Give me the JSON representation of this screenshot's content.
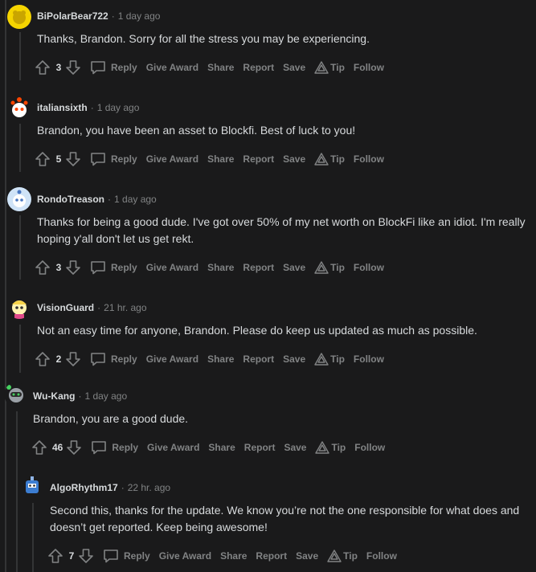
{
  "comments": [
    {
      "user": "BiPolarBear722",
      "time": "1 day ago",
      "body": "Thanks, Brandon. Sorry for all the stress you may be experiencing.",
      "score": "3"
    },
    {
      "user": "italiansixth",
      "time": "1 day ago",
      "body": "Brandon, you have been an asset to Blockfi. Best of luck to you!",
      "score": "5"
    },
    {
      "user": "RondoTreason",
      "time": "1 day ago",
      "body": "Thanks for being a good dude. I've got over 50% of my net worth on BlockFi like an idiot. I'm really hoping y'all don't let us get rekt.",
      "score": "3"
    },
    {
      "user": "VisionGuard",
      "time": "21 hr. ago",
      "body": "Not an easy time for anyone, Brandon. Please do keep us updated as much as possible.",
      "score": "2"
    },
    {
      "user": "Wu-Kang",
      "time": "1 day ago",
      "body": "Brandon, you are a good dude.",
      "score": "46"
    },
    {
      "user": "AlgoRhythm17",
      "time": "22 hr. ago",
      "body": "Second this, thanks for the update. We know you’re not the one responsible for what does and doesn’t get reported. Keep being awesome!",
      "score": "7"
    }
  ],
  "actions": {
    "reply": "Reply",
    "give_award": "Give Award",
    "share": "Share",
    "report": "Report",
    "save": "Save",
    "tip": "Tip",
    "follow": "Follow"
  },
  "separator": "·",
  "colors": {
    "background": "#1a1a1b",
    "text": "#d7dadc",
    "meta": "#818384",
    "thread_line": "#343536"
  }
}
